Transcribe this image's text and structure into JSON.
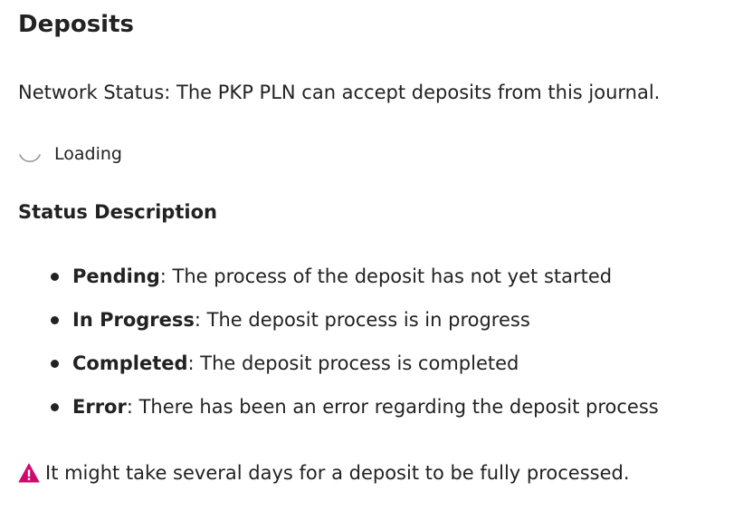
{
  "page": {
    "title": "Deposits",
    "network_status": "Network Status: The PKP PLN can accept deposits from this journal.",
    "loading_label": "Loading",
    "status_heading": "Status Description",
    "statuses": [
      {
        "term": "Pending",
        "description": ": The process of the deposit has not yet started"
      },
      {
        "term": "In Progress",
        "description": ": The deposit process is in progress"
      },
      {
        "term": "Completed",
        "description": ": The deposit process is completed"
      },
      {
        "term": "Error",
        "description": ": There has been an error regarding the deposit process"
      }
    ],
    "notice": "It might take several days for a deposit to be fully processed."
  },
  "icons": {
    "spinner": "loading-spinner-icon",
    "warning": "warning-triangle-icon"
  },
  "colors": {
    "text": "#222222",
    "warning": "#d00a6c",
    "spinner": "#999999"
  }
}
